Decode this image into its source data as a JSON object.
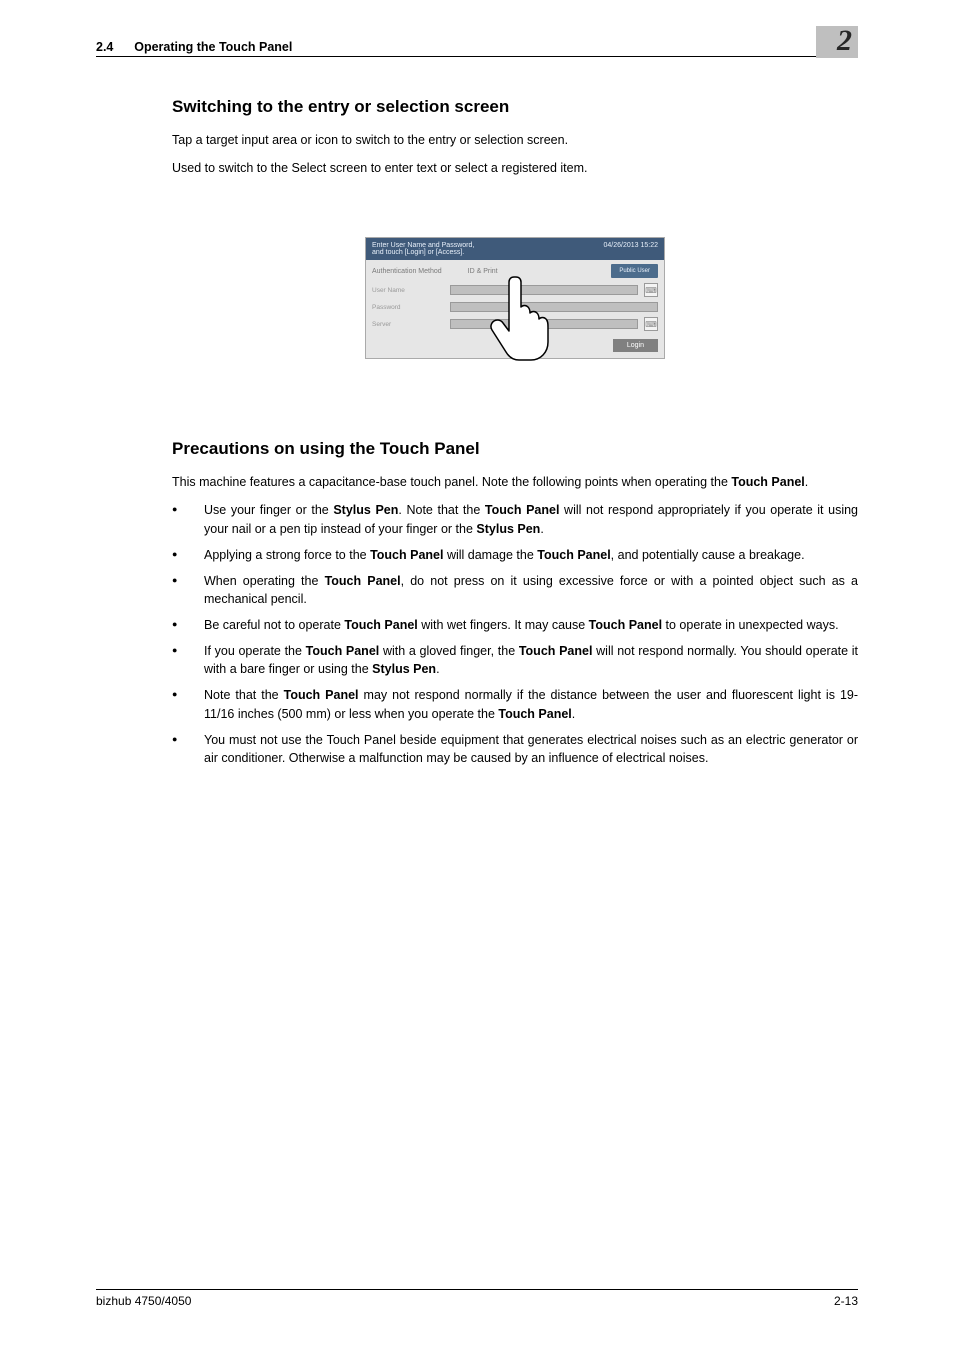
{
  "header": {
    "section_no": "2.4",
    "section_title": "Operating the Touch Panel",
    "chapter_no": "2"
  },
  "section1": {
    "heading": "Switching to the entry or selection screen",
    "para1": "Tap a target input area or icon to switch to the entry or selection screen.",
    "para2": "Used to switch to the Select screen to enter text or select a registered item."
  },
  "figure": {
    "title_line1": "Enter User Name and Password,",
    "title_line2": "and touch [Login] or [Access].",
    "datetime": "04/26/2013 15:22",
    "auth_method": "Authentication Method",
    "auth_value": "ID & Print",
    "public_user": "Public User",
    "user_name": "User Name",
    "password": "Password",
    "server": "Server",
    "login": "Login"
  },
  "section2": {
    "heading": "Precautions on using the Touch Panel",
    "intro_pre": "This machine features a capacitance-base touch panel. Note the following points when operating the ",
    "intro_b1": "Touch Panel",
    "intro_post": ".",
    "bullets": [
      {
        "t1": "Use your finger or the ",
        "b1": "Stylus Pen",
        "t2": ". Note that the ",
        "b2": "Touch Panel",
        "t3": " will not respond appropriately if you operate it using your nail or a pen tip instead of your finger or the ",
        "b3": "Stylus Pen",
        "t4": "."
      },
      {
        "t1": "Applying a strong force to the ",
        "b1": "Touch Panel",
        "t2": " will damage the ",
        "b2": "Touch Panel",
        "t3": ", and potentially cause a breakage."
      },
      {
        "t1": "When operating the ",
        "b1": "Touch Panel",
        "t2": ", do not press on it using excessive force or with a pointed object such as a mechanical pencil."
      },
      {
        "t1": "Be careful not to operate ",
        "b1": "Touch Panel",
        "t2": " with wet fingers. It may cause ",
        "b2": "Touch Panel",
        "t3": " to operate in unexpected ways."
      },
      {
        "t1": "If you operate the ",
        "b1": "Touch Panel",
        "t2": " with a gloved finger, the ",
        "b2": "Touch Panel",
        "t3": " will not respond normally. You should operate it with a bare finger or using the ",
        "b3": "Stylus Pen",
        "t4": "."
      },
      {
        "t1": "Note that the ",
        "b1": "Touch Panel",
        "t2": " may not respond normally if the distance between the user and fluorescent light is 19-11/16 inches (500 mm) or less when you operate the ",
        "b2": "Touch Panel",
        "t3": "."
      },
      {
        "t1": "You must not use the Touch Panel beside equipment that generates electrical noises such as an electric generator or air conditioner. Otherwise a malfunction may be caused by an influence of electrical noises."
      }
    ]
  },
  "footer": {
    "product": "bizhub 4750/4050",
    "page": "2-13"
  }
}
